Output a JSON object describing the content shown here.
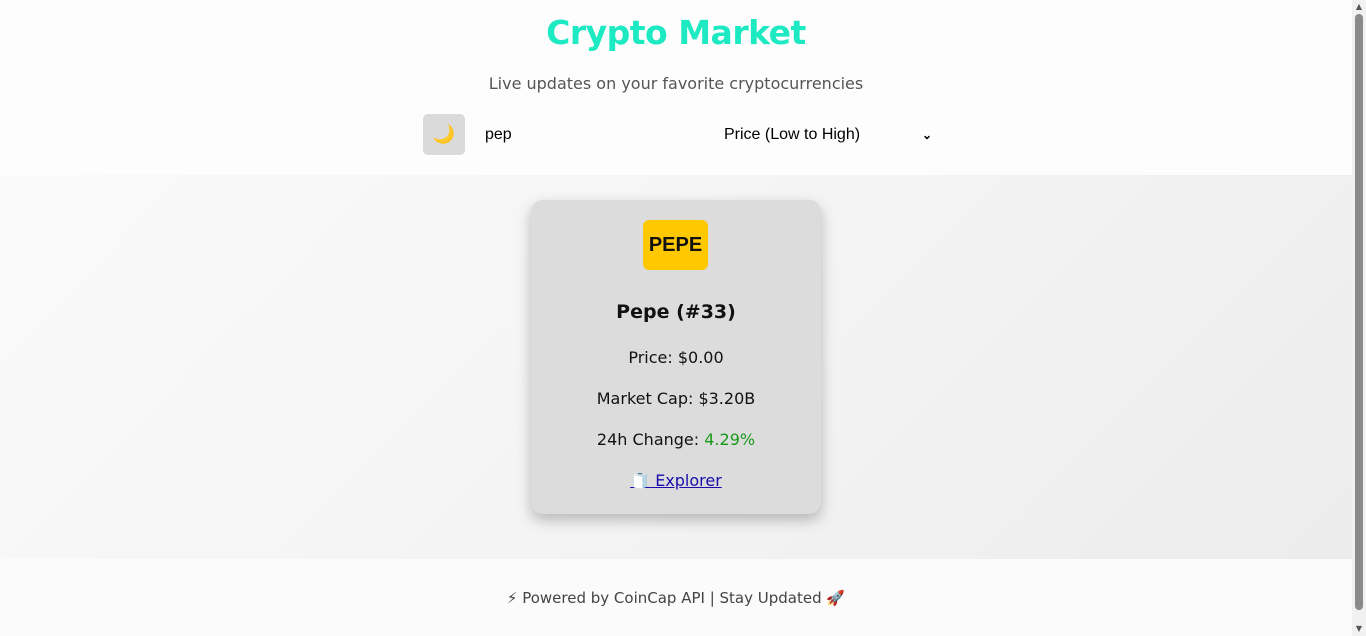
{
  "header": {
    "title": "Crypto Market",
    "subtitle": "Live updates on your favorite cryptocurrencies"
  },
  "controls": {
    "theme_icon": "🌙",
    "search_value": "pep",
    "sort_selected": "Price (Low to High)"
  },
  "card": {
    "symbol": "PEPE",
    "name": "Pepe (#33)",
    "price_label": "Price: $0.00",
    "market_cap_label": "Market Cap: $3.20B",
    "change_prefix": "24h Change: ",
    "change_value": "4.29%",
    "explorer_icon": "🧻",
    "explorer_label": "Explorer"
  },
  "footer": {
    "text": "⚡ Powered by CoinCap API | Stay Updated 🚀"
  },
  "colors": {
    "title": "#1de9c3",
    "symbol_bg": "#ffc800",
    "positive": "#1a9a1a",
    "link": "#1a0dab"
  }
}
